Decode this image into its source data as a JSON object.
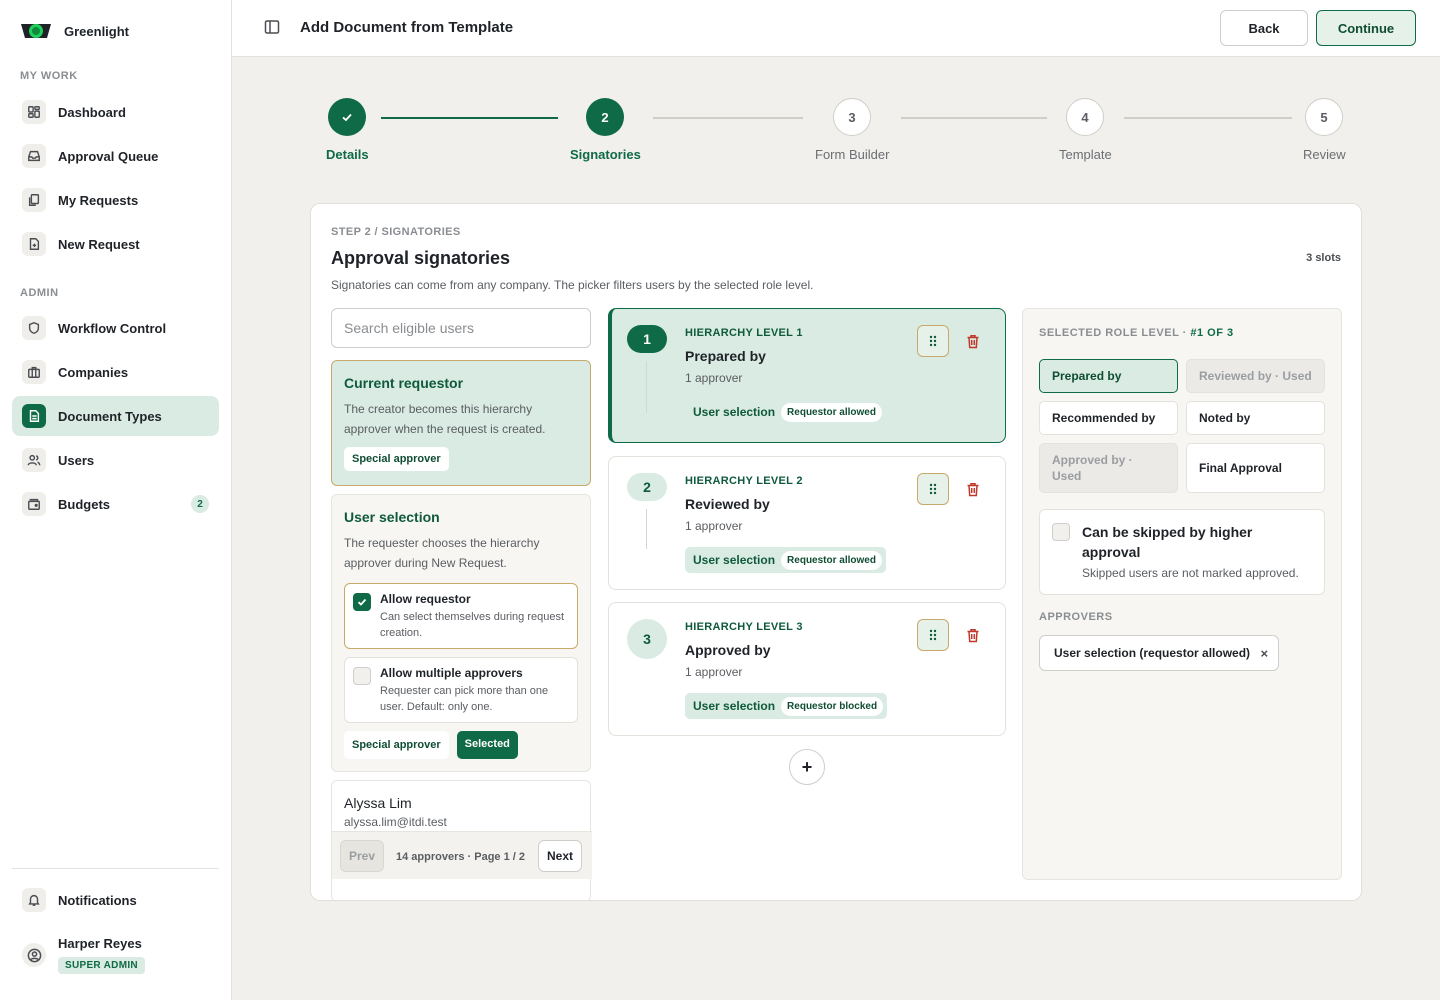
{
  "app": {
    "name": "Greenlight"
  },
  "sidebar": {
    "sections": [
      {
        "label": "MY WORK"
      },
      {
        "label": "ADMIN"
      }
    ],
    "items": [
      {
        "label": "Dashboard"
      },
      {
        "label": "Approval Queue"
      },
      {
        "label": "My Requests"
      },
      {
        "label": "New Request"
      },
      {
        "label": "Workflow Control"
      },
      {
        "label": "Companies"
      },
      {
        "label": "Document Types"
      },
      {
        "label": "Users"
      },
      {
        "label": "Budgets",
        "badge": "2"
      }
    ],
    "active_item": "Document Types",
    "notifications": "Notifications",
    "user": {
      "name": "Harper Reyes",
      "role": "SUPER ADMIN"
    }
  },
  "header": {
    "title": "Add Document from Template",
    "back_label": "Back",
    "continue_label": "Continue"
  },
  "stepper": {
    "steps": [
      {
        "label": "Details",
        "number": "1",
        "state": "done"
      },
      {
        "label": "Signatories",
        "number": "2",
        "state": "current"
      },
      {
        "label": "Form Builder",
        "number": "3",
        "state": "todo"
      },
      {
        "label": "Template",
        "number": "4",
        "state": "todo"
      },
      {
        "label": "Review",
        "number": "5",
        "state": "todo"
      }
    ]
  },
  "card": {
    "eyebrow": "STEP 2 / SIGNATORIES",
    "title": "Approval signatories",
    "subtitle": "Signatories can come from any company. The picker filters users by the selected role level.",
    "slots": "3 slots"
  },
  "left": {
    "search_placeholder": "Search eligible users",
    "requestor": {
      "title": "Current requestor",
      "description": "The creator becomes this hierarchy approver when the request is created.",
      "pill": "Special approver"
    },
    "user_selection": {
      "title": "User selection",
      "description": "The requester chooses the hierarchy approver during New Request.",
      "options": [
        {
          "title": "Allow requestor",
          "description": "Can select themselves during request creation.",
          "checked": true
        },
        {
          "title": "Allow multiple approvers",
          "description": "Requester can pick more than one user. Default: only one.",
          "checked": false
        }
      ],
      "pill_special": "Special approver",
      "pill_selected": "Selected"
    },
    "user_list": {
      "name": "Alyssa Lim",
      "email": "alyssa.lim@itdi.test",
      "prev": "Prev",
      "next": "Next",
      "info": "14 approvers · Page 1 / 2"
    }
  },
  "levels": [
    {
      "number": "1",
      "eyebrow": "HIERARCHY LEVEL 1",
      "title": "Prepared by",
      "count": "1 approver",
      "tag": "User selection",
      "tag_badge": "Requestor allowed",
      "active": true
    },
    {
      "number": "2",
      "eyebrow": "HIERARCHY LEVEL 2",
      "title": "Reviewed by",
      "count": "1 approver",
      "tag": "User selection",
      "tag_badge": "Requestor allowed",
      "active": false
    },
    {
      "number": "3",
      "eyebrow": "HIERARCHY LEVEL 3",
      "title": "Approved by",
      "count": "1 approver",
      "tag": "User selection",
      "tag_badge": "Requestor blocked",
      "active": false
    }
  ],
  "add_level": "+",
  "right": {
    "eyebrow": "SELECTED ROLE LEVEL · ",
    "eyebrow_accent": "#1 OF 3",
    "roles": [
      {
        "label": "Prepared by",
        "state": "selected"
      },
      {
        "label": "Reviewed by · Used",
        "state": "used"
      },
      {
        "label": "Recommended by",
        "state": "normal"
      },
      {
        "label": "Noted by",
        "state": "normal"
      },
      {
        "label": "Approved by · Used",
        "state": "used"
      },
      {
        "label": "Final Approval",
        "state": "normal"
      }
    ],
    "skip": {
      "title": "Can be skipped by higher approval",
      "description": "Skipped users are not marked approved."
    },
    "approvers_label": "APPROVERS",
    "approver_chip": "User selection (requestor allowed)",
    "chip_close": "×"
  },
  "colors": {
    "brand": "#0f6a47",
    "brand_light": "#d9ebe2",
    "accent_border": "#c8a96a",
    "danger": "#c0392b",
    "page_bg": "#f1f0ec"
  }
}
